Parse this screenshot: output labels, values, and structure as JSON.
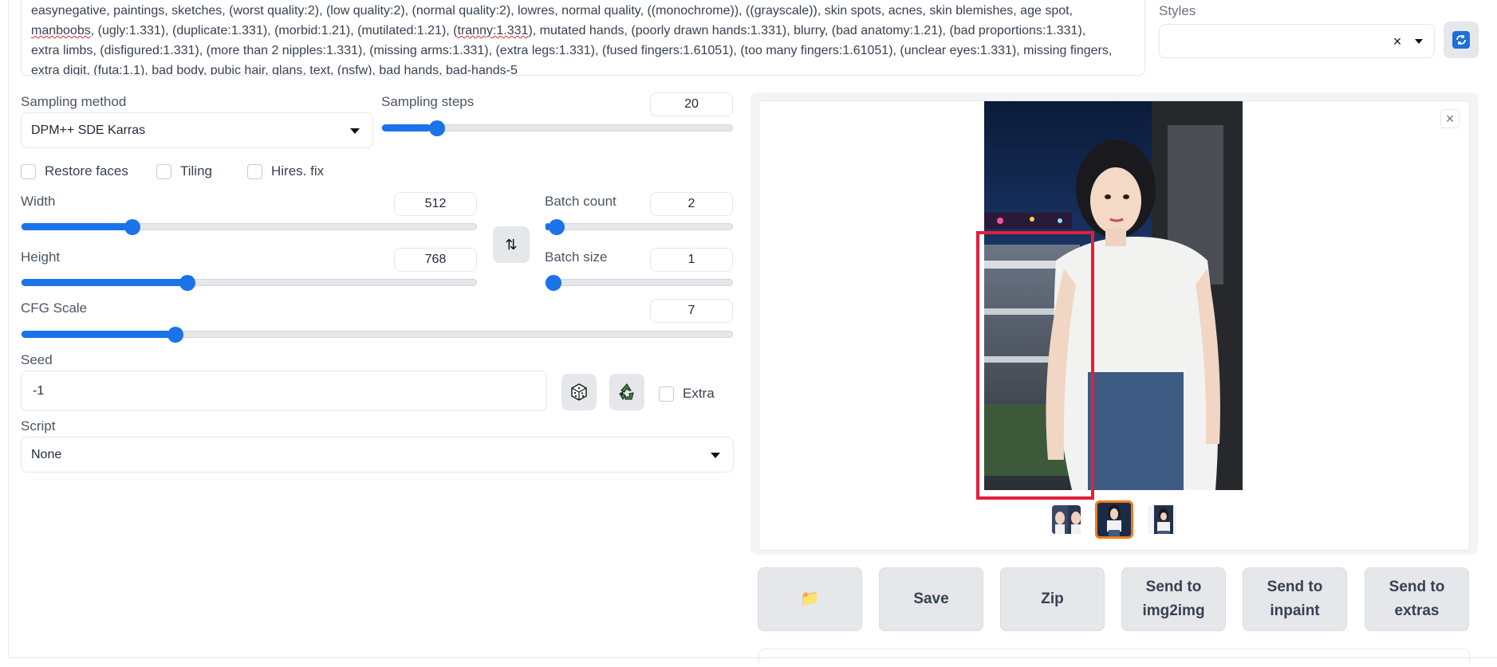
{
  "negative_prompt": {
    "line1": "easynegative, paintings, sketches, (worst quality:2), (low quality:2), (normal quality:2), lowres, normal quality, ((monochrome)), ((grayscale)), skin spots, acnes, skin blemishes, age spot,",
    "line2_parts": [
      "manboobs",
      ", (ugly:1.331), (duplicate:1.331), (morbid:1.21), (mutilated:1.21), (",
      "tranny:1.331",
      "), mutated hands, (poorly drawn hands:1.331), blurry, (bad anatomy:1.21), (bad proportions:1.331),"
    ],
    "line3": "extra limbs, (disfigured:1.331), (more than 2 nipples:1.331), (missing arms:1.331), (extra legs:1.331), (fused fingers:1.61051), (too many fingers:1.61051), (unclear eyes:1.331), missing fingers,",
    "line4_parts": [
      "extra digit, (",
      "futa:1.1",
      "), bad body, pubic hair, glans, text, (",
      "nsfw",
      "), bad hands, bad-hands-5"
    ]
  },
  "styles": {
    "label": "Styles",
    "clear_glyph": "×"
  },
  "sampling_method": {
    "label": "Sampling method",
    "value": "DPM++ SDE Karras"
  },
  "sampling_steps": {
    "label": "Sampling steps",
    "value": "20",
    "fraction": 0.14
  },
  "checkboxes": {
    "restore_faces": "Restore faces",
    "tiling": "Tiling",
    "hires_fix": "Hires. fix"
  },
  "width": {
    "label": "Width",
    "value": "512",
    "fraction": 0.235
  },
  "height": {
    "label": "Height",
    "value": "768",
    "fraction": 0.36
  },
  "batch_count": {
    "label": "Batch count",
    "value": "2",
    "fraction": 0.02
  },
  "batch_size": {
    "label": "Batch size",
    "value": "1",
    "fraction": 0.0
  },
  "cfg_scale": {
    "label": "CFG Scale",
    "value": "7",
    "fraction": 0.21
  },
  "swap_glyph": "⇅",
  "seed": {
    "label": "Seed",
    "value": "-1",
    "extra_label": "Extra"
  },
  "script": {
    "label": "Script",
    "value": "None"
  },
  "gallery": {
    "close_glyph": "×"
  },
  "actions": {
    "folder_glyph": "📁",
    "save": "Save",
    "zip": "Zip",
    "send_img2img": "Send to img2img",
    "send_inpaint": "Send to inpaint",
    "send_extras": "Send to extras"
  },
  "colors": {
    "accent": "#1a73e8",
    "selection": "#e0203a",
    "thumb_selected": "#f07b1a"
  }
}
